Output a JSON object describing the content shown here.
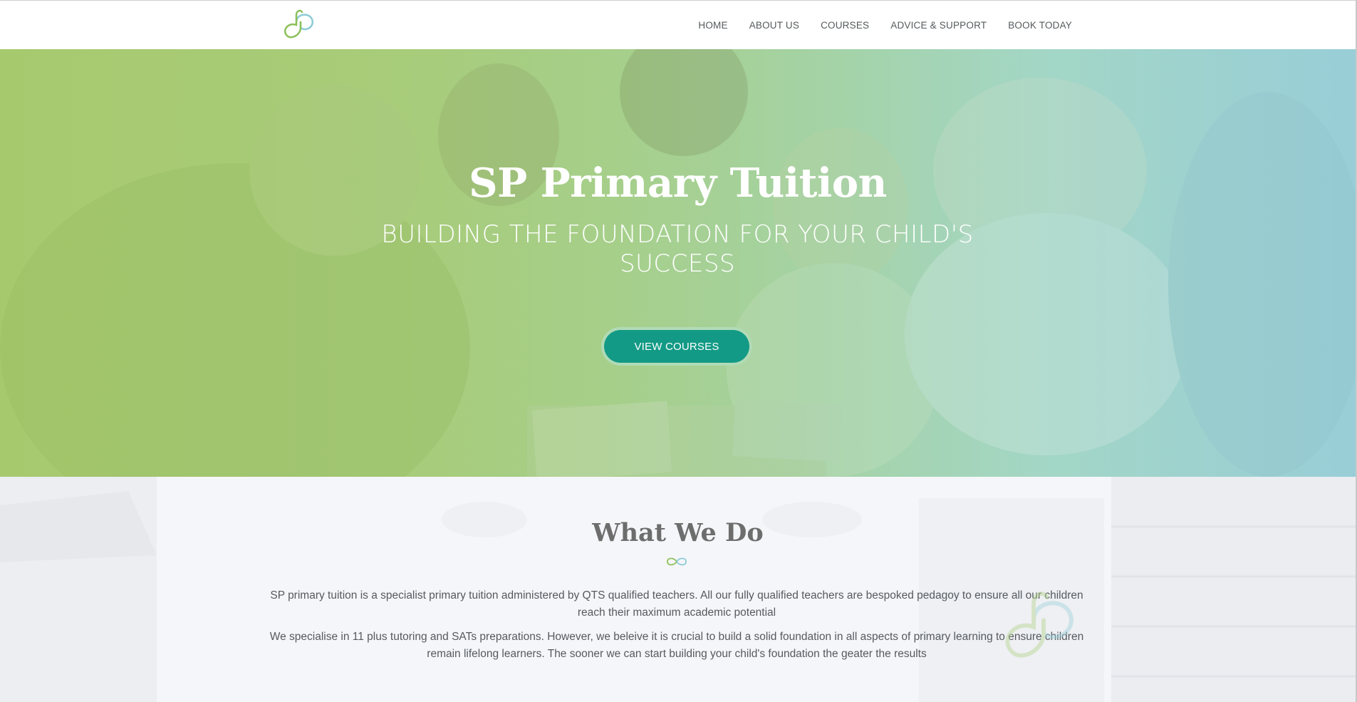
{
  "header": {
    "logo": {
      "icon": "sp-infinity-logo",
      "colors": [
        "#8cc05a",
        "#8ccbd6"
      ]
    },
    "nav": [
      {
        "label": "HOME"
      },
      {
        "label": "ABOUT US"
      },
      {
        "label": "COURSES"
      },
      {
        "label": "ADVICE & SUPPORT"
      },
      {
        "label": "BOOK TODAY"
      }
    ]
  },
  "hero": {
    "title": "SP Primary Tuition",
    "subtitle": "BUILDING THE FOUNDATION FOR YOUR CHILD'S SUCCESS",
    "cta_label": "VIEW COURSES",
    "colors": {
      "gradient_start": "#a4c46e",
      "gradient_end": "#9ccfd8",
      "button": "#139a86"
    }
  },
  "what_we_do": {
    "title": "What We Do",
    "divider_icon": "infinity-icon",
    "paragraphs": [
      "SP primary tuition is a specialist primary tuition administered by QTS qualified teachers. All our fully qualified teachers are bespoked pedagoy to ensure all our children reach their maximum academic potential",
      "We specialise in 11 plus tutoring and SATs preparations. However, we beleive it is crucial to build a solid foundation in all aspects of primary learning to ensure children remain lifelong learners. The sooner we can start building your child's foundation the geater the results"
    ]
  }
}
